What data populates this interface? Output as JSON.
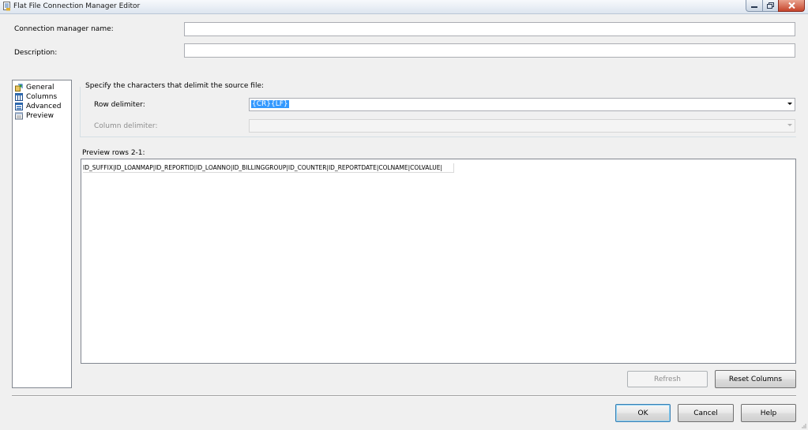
{
  "window": {
    "title": "Flat File Connection Manager Editor",
    "controls": {
      "minimize": "—",
      "maximize": "❐",
      "close": "✕"
    }
  },
  "fields": {
    "connection_name_label": "Connection manager name:",
    "connection_name_value": "",
    "description_label": "Description:",
    "description_value": ""
  },
  "nav": {
    "items": [
      {
        "label": "General",
        "icon": "general-icon"
      },
      {
        "label": "Columns",
        "icon": "columns-icon"
      },
      {
        "label": "Advanced",
        "icon": "advanced-icon"
      },
      {
        "label": "Preview",
        "icon": "preview-icon"
      }
    ]
  },
  "delimiters": {
    "group_label": "Specify the characters that delimit the source file:",
    "row_label": "Row delimiter:",
    "row_value": "{CR}{LF}",
    "column_label": "Column delimiter:",
    "column_value": ""
  },
  "preview": {
    "label": "Preview rows 2-1:",
    "header_row": "ID_SUFFIX|ID_LOANMAP|ID_REPORTID|ID_LOANNO|ID_BILLINGGROUP|ID_COUNTER|ID_REPORTDATE|COLNAME|COLVALUE|"
  },
  "buttons": {
    "refresh": "Refresh",
    "reset_columns": "Reset Columns",
    "ok": "OK",
    "cancel": "Cancel",
    "help": "Help"
  },
  "colors": {
    "selection": "#3399ff",
    "window_bg": "#f0f0f0",
    "close_button": "#c6452b"
  }
}
